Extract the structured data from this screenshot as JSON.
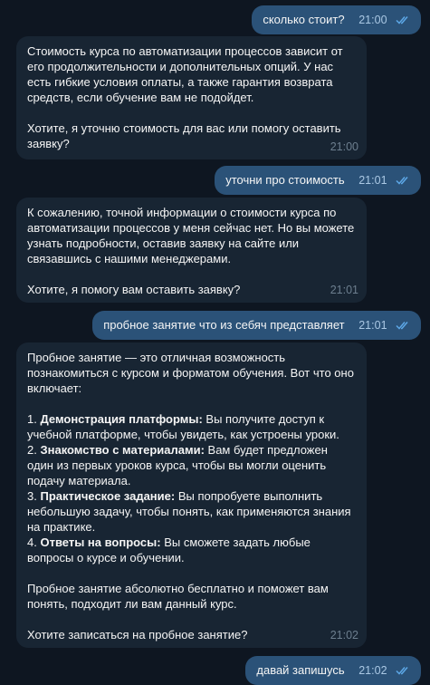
{
  "colors": {
    "background": "#0e1621",
    "outgoing_bubble": "#2b5278",
    "incoming_bubble": "#182533",
    "read_checks": "#5ca7e6"
  },
  "messages": [
    {
      "dir": "out",
      "text": "сколько стоит?",
      "time": "21:00"
    },
    {
      "dir": "in",
      "p1": "Стоимость курса по автоматизации процессов зависит от его продолжительности и дополнительных опций. У нас есть гибкие условия оплаты, а также гарантия возврата средств, если обучение вам не подойдет.",
      "p2": "Хотите, я уточню стоимость для вас или помогу оставить заявку?",
      "time": "21:00"
    },
    {
      "dir": "out",
      "text": "уточни про стоимость",
      "time": "21:01"
    },
    {
      "dir": "in",
      "p1": "К сожалению, точной информации о стоимости курса по автоматизации процессов у меня сейчас нет. Но вы можете узнать подробности, оставив заявку на сайте или связавшись с нашими менеджерами.",
      "p2": "Хотите, я помогу вам оставить заявку?",
      "time": "21:01"
    },
    {
      "dir": "out",
      "text": "пробное занятие что из себяч представляет",
      "time": "21:01"
    },
    {
      "dir": "in",
      "intro": "Пробное занятие — это отличная возможность познакомиться с курсом и форматом обучения. Вот что оно включает:",
      "items": [
        {
          "num": "1.",
          "title": "Демонстрация платформы:",
          "text": " Вы получите доступ к учебной платформе, чтобы увидеть, как устроены уроки."
        },
        {
          "num": "2.",
          "title": "Знакомство с материалами:",
          "text": " Вам будет предложен один из первых уроков курса, чтобы вы могли оценить подачу материала."
        },
        {
          "num": "3.",
          "title": "Практическое задание:",
          "text": " Вы попробуете выполнить небольшую задачу, чтобы понять, как применяются знания на практике."
        },
        {
          "num": "4.",
          "title": "Ответы на вопросы:",
          "text": " Вы сможете задать любые вопросы о курсе и обучении."
        }
      ],
      "p2": "Пробное занятие абсолютно бесплатно и поможет вам понять, подходит ли вам данный курс.",
      "p3": "Хотите записаться на пробное занятие?",
      "time": "21:02"
    },
    {
      "dir": "out",
      "text": "давай запишусь",
      "time": "21:02"
    }
  ]
}
